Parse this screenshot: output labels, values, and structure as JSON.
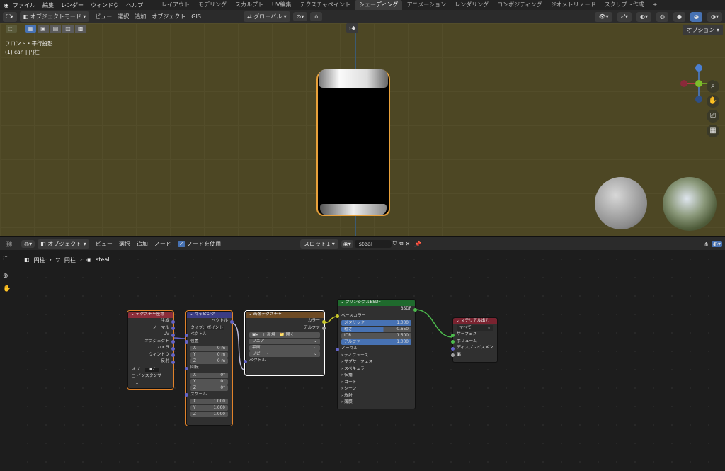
{
  "topbar": {
    "menus": [
      "ファイル",
      "編集",
      "レンダー",
      "ウィンドウ",
      "ヘルプ"
    ],
    "workspaces": [
      "レイアウト",
      "モデリング",
      "スカルプト",
      "UV編集",
      "テクスチャペイント",
      "シェーディング",
      "アニメーション",
      "レンダリング",
      "コンポジティング",
      "ジオメトリノード",
      "スクリプト作成",
      "+"
    ],
    "active_workspace": "シェーディング"
  },
  "viewport_header": {
    "mode": "オブジェクトモード",
    "menus": [
      "ビュー",
      "選択",
      "追加",
      "オブジェクト",
      "GIS"
    ],
    "orientation": "グローバル",
    "options": "オプション"
  },
  "viewport": {
    "view_name": "フロント・平行投影",
    "object_info": "(1) can | 円柱"
  },
  "node_header": {
    "editor_type": "オブジェクト",
    "menus": [
      "ビュー",
      "選択",
      "追加",
      "ノード"
    ],
    "use_nodes": "ノードを使用",
    "slot": "スロット1",
    "material": "steal"
  },
  "breadcrumb": {
    "object": "円柱",
    "mesh": "円柱",
    "material": "steal"
  },
  "nodes": {
    "texcoord": {
      "title": "テクスチャ座標",
      "outputs": [
        "生成",
        "ノーマル",
        "UV",
        "オブジェクト",
        "カメラ",
        "ウィンドウ",
        "反射"
      ],
      "object_label": "オブ...",
      "instancer": "インスタンサー..."
    },
    "mapping": {
      "title": "マッピング",
      "out": "ベクトル",
      "type_label": "タイプ:",
      "type_value": "ポイント",
      "in_vector": "ベクトル",
      "location": "位置",
      "loc": [
        [
          "X",
          "0 m"
        ],
        [
          "Y",
          "0 m"
        ],
        [
          "Z",
          "0 m"
        ]
      ],
      "rotation": "回転",
      "rot": [
        [
          "X",
          "0°"
        ],
        [
          "Y",
          "0°"
        ],
        [
          "Z",
          "0°"
        ]
      ],
      "scale": "スケール",
      "scl": [
        [
          "X",
          "1.000"
        ],
        [
          "Y",
          "1.000"
        ],
        [
          "Z",
          "1.000"
        ]
      ]
    },
    "image": {
      "title": "画像テクスチャ",
      "out_color": "カラー",
      "out_alpha": "アルファ",
      "new": "新規",
      "open": "開く",
      "interp": "リニア",
      "proj": "平面",
      "ext": "リピート",
      "in_vector": "ベクトル"
    },
    "bsdf": {
      "title": "プリンシプルBSDF",
      "out": "BSDF",
      "base_color": "ベースカラー",
      "metallic": "メタリック",
      "metallic_val": "1.000",
      "rough": "粗さ",
      "rough_val": "0.650",
      "ior": "IOR",
      "ior_val": "1.500",
      "alpha": "アルファ",
      "alpha_val": "1.000",
      "normal": "ノーマル",
      "panels": [
        "ディフューズ",
        "サブサーフェス",
        "スペキュラー",
        "伝播",
        "コート",
        "シーン",
        "放射",
        "薄膜"
      ]
    },
    "output": {
      "title": "マテリアル出力",
      "target": "すべて",
      "inputs": [
        "サーフェス",
        "ボリューム",
        "ディスプレイスメント",
        "幅"
      ]
    }
  },
  "colors": {
    "viewport_bg": "#4d4724",
    "selection": "#e9a13a",
    "texture_header": "#8b2d3a",
    "vector_header": "#3c3c83",
    "color_header": "#6e4b25",
    "shader_header": "#1f6a2d",
    "output_header": "#7a2330"
  }
}
